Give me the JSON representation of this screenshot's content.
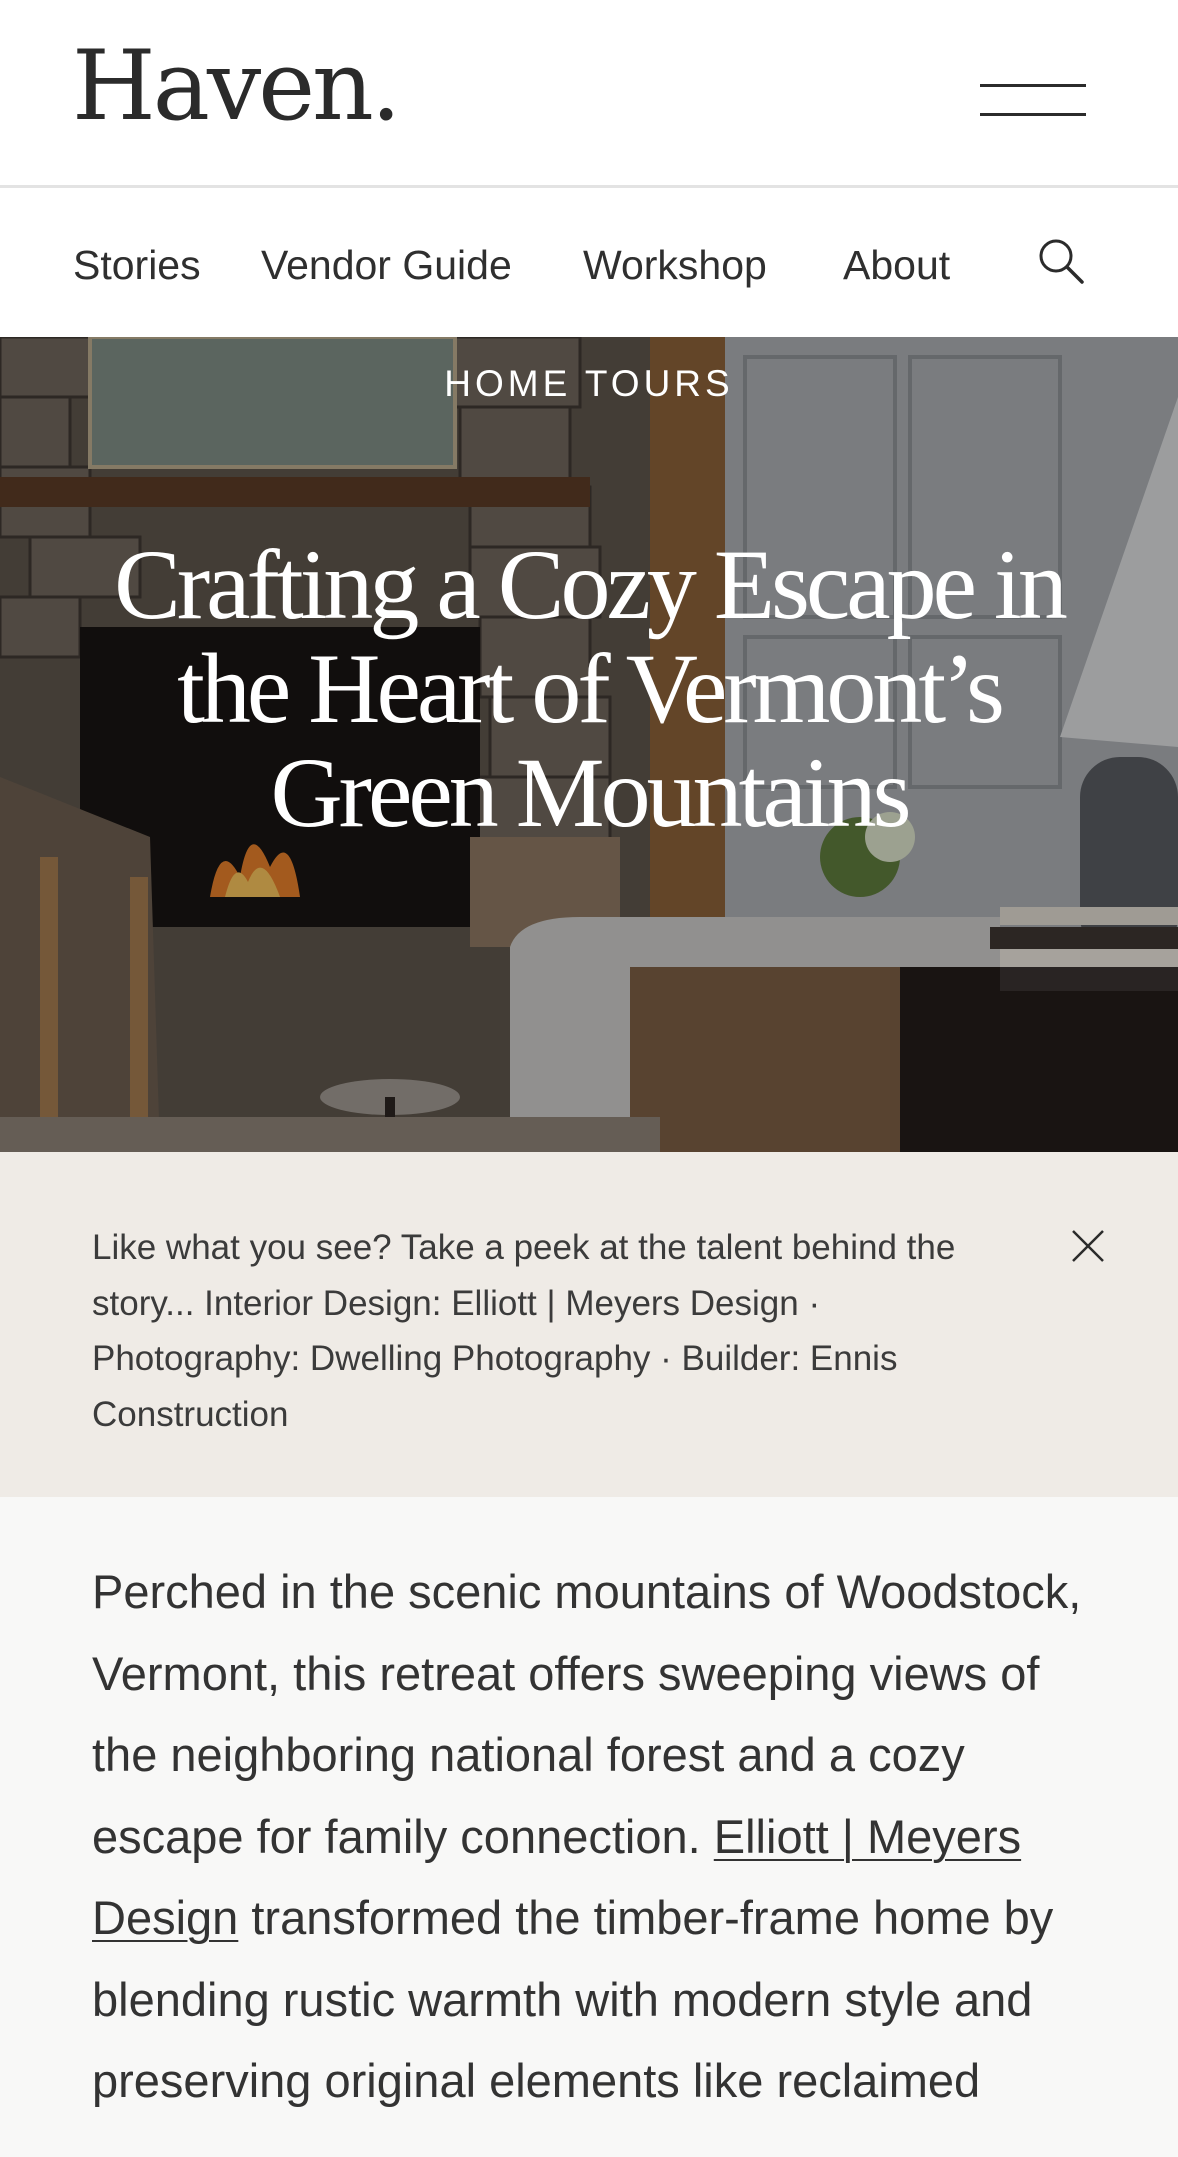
{
  "header": {
    "logo": "Haven.",
    "menu_icon": "hamburger-menu-icon"
  },
  "nav": {
    "items": [
      {
        "label": "Stories"
      },
      {
        "label": "Vendor Guide"
      },
      {
        "label": "Workshop"
      },
      {
        "label": "About"
      }
    ],
    "search_icon": "search-icon"
  },
  "hero": {
    "category": "HOME TOURS",
    "title": "Crafting a Cozy Escape in the Heart of Vermont’s Green Mountains"
  },
  "credits": {
    "text": "Like what you see? Take a peek at the talent behind the story... Interior Design: Elliott | Meyers Design · Photography: Dwelling Photography · Builder: Ennis Construction",
    "close_icon": "close-icon"
  },
  "article": {
    "intro_before_link": "Perched in the scenic mountains of Woodstock, Vermont, this retreat offers sweeping views of the neighboring national forest and a cozy escape for family connection. ",
    "link_text": "Elliott | Meyers Design",
    "intro_after_link": " transformed the timber-frame home by blending rustic warmth with modern style and preserving original elements like reclaimed"
  },
  "colors": {
    "credits_background": "#efebe6",
    "article_background": "#f8f8f7",
    "text": "#2f2f2f"
  }
}
